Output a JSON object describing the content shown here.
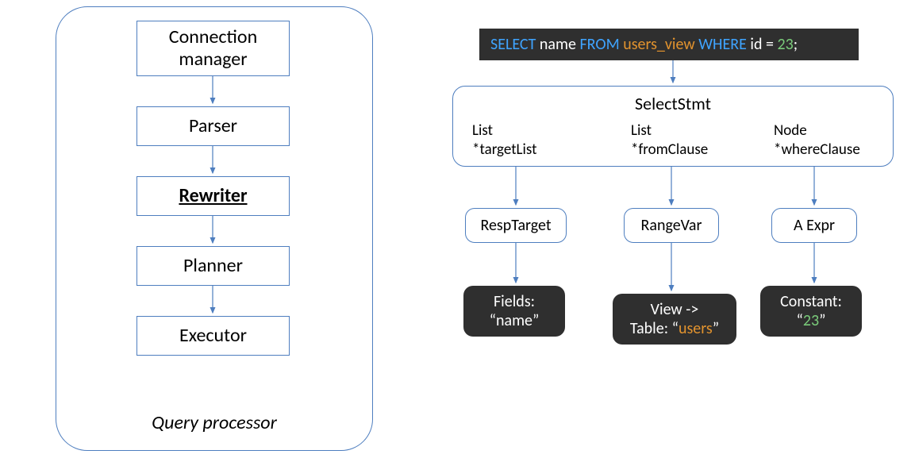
{
  "left": {
    "boxes": {
      "conn1": "Connection",
      "conn2": "manager",
      "parser": "Parser",
      "rewriter": "Rewriter",
      "planner": "Planner",
      "executor": "Executor"
    },
    "label": "Query processor"
  },
  "sql": {
    "select": "SELECT",
    "name": " name ",
    "from": "FROM",
    "view": " users_view ",
    "where": "WHERE",
    "idEq": " id = ",
    "num": "23",
    "semi": ";"
  },
  "stmt": {
    "title": "SelectStmt",
    "col1a": "List",
    "col1b": "*targetList",
    "col2a": "List",
    "col2b": "*fromClause",
    "col3a": "Node",
    "col3b": "*whereClause"
  },
  "nodes": {
    "resp": "RespTarget",
    "range": "RangeVar",
    "aexpr": "A Expr"
  },
  "leaves": {
    "fields1": "Fields:",
    "fields2": "“name”",
    "view1": "View ->",
    "view2a": "Table: “",
    "view2b": "users",
    "view2c": "”",
    "const1": "Constant:",
    "const2a": "“",
    "const2b": "23",
    "const2c": "”"
  }
}
